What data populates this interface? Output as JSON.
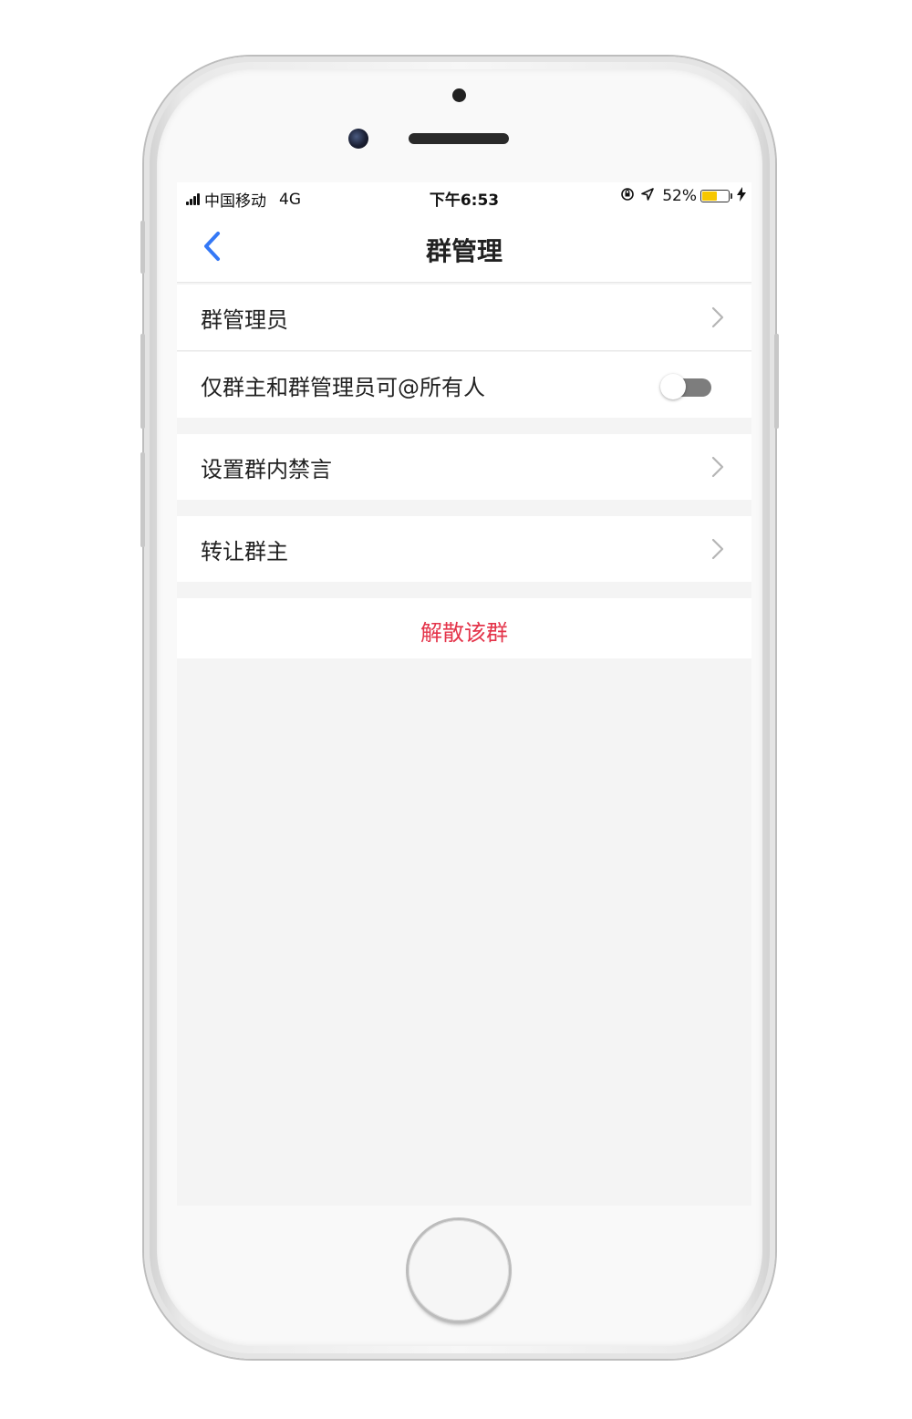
{
  "status_bar": {
    "carrier": "中国移动",
    "network": "4G",
    "time": "下午6:53",
    "battery_percent": "52%",
    "battery_level": 0.52,
    "icons": [
      "signal-icon",
      "orientation-lock-icon",
      "location-icon",
      "battery-icon",
      "charging-icon"
    ]
  },
  "nav": {
    "title": "群管理",
    "back_icon": "chevron-left-icon",
    "accent_color": "#3478f6"
  },
  "settings": {
    "group_admins": {
      "label": "群管理员"
    },
    "mention_all": {
      "label": "仅群主和群管理员可@所有人",
      "enabled": false
    },
    "mute": {
      "label": "设置群内禁言"
    },
    "transfer": {
      "label": "转让群主"
    },
    "dissolve": {
      "label": "解散该群",
      "color": "#e4344a"
    }
  }
}
